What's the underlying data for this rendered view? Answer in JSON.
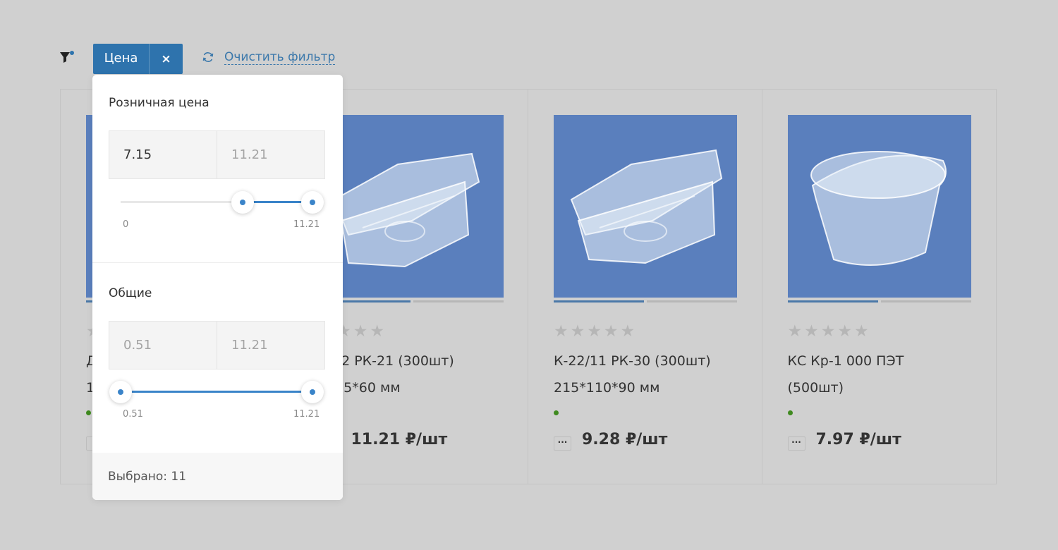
{
  "filter_bar": {
    "chip_label": "Цена",
    "chip_close": "×",
    "reset_label": "Очистить фильтр",
    "accent_color": "#2e73ad"
  },
  "products": [
    {
      "rating_stars": "★★★★★",
      "name": "Д",
      "size": "19",
      "qty_label": "",
      "price": ""
    },
    {
      "rating_stars": "★★★★",
      "name": "9/12 РК-21 (300шт)",
      "size": "*115*60 мм",
      "qty_label": "",
      "price": "11.21 ₽/шт"
    },
    {
      "rating_stars": "★★★★★",
      "name": "К-22/11 РК-30 (300шт)",
      "size": "215*110*90 мм",
      "qty_label": "···",
      "price": "9.28 ₽/шт"
    },
    {
      "rating_stars": "★★★★★",
      "name": "КС Кр-1 000 ПЭТ",
      "size": "(500шт)",
      "qty_label": "···",
      "price": "7.97 ₽/шт"
    }
  ],
  "price_filter": {
    "retail": {
      "title": "Розничная цена",
      "from_value": "7.15",
      "to_value": "11.21",
      "min_label": "0",
      "max_label": "11.21",
      "range_min": 0,
      "range_max": 11.21,
      "selected_from": 7.15,
      "selected_to": 11.21
    },
    "general": {
      "title": "Общие",
      "from_value": "0.51",
      "to_value": "11.21",
      "min_label": "0.51",
      "max_label": "11.21",
      "range_min": 0.51,
      "range_max": 11.21,
      "selected_from": 0.51,
      "selected_to": 11.21
    },
    "selected_text": "Выбрано: 11"
  }
}
